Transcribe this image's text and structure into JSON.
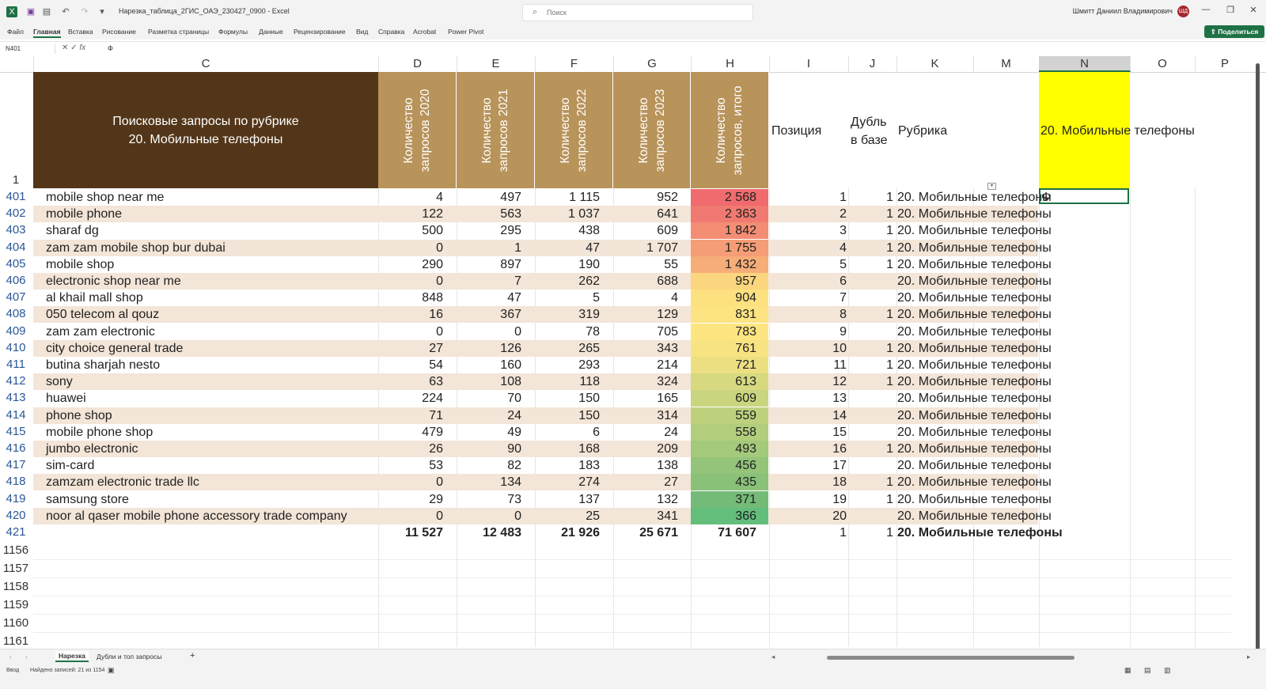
{
  "window": {
    "app_name": "Excel",
    "doc_title": "Нарезка_таблица_2ГИС_ОАЭ_230427_0900  -  Excel",
    "search_placeholder": "Поиск",
    "user_name": "Шмитт Даниил Владимирович",
    "user_initials": "ШД"
  },
  "menu": [
    "Файл",
    "Главная",
    "Вставка",
    "Рисование",
    "Разметка страницы",
    "Формулы",
    "Данные",
    "Рецензирование",
    "Вид",
    "Справка",
    "Acrobat",
    "Power Pivot"
  ],
  "share_label": "Поделиться",
  "formula_bar": {
    "name_box": "N401",
    "fx": "fx",
    "value": "Ф"
  },
  "columns": [
    "C",
    "D",
    "E",
    "F",
    "G",
    "H",
    "I",
    "J",
    "K",
    "M",
    "N",
    "O",
    "P"
  ],
  "header": {
    "title_line1": "Поисковые запросы по рубрике",
    "title_line2": "20. Мобильные телефоны",
    "col_d": "Количество запросов 2020",
    "col_e": "Количество запросов 2021",
    "col_f": "Количество запросов 2022",
    "col_g": "Количество запросов 2023",
    "col_h": "Количество запросов, итого",
    "col_i": "Позиция",
    "col_j": "Дубль в базе",
    "col_k": "Рубрика",
    "col_n": "20. Мобильные телефоны",
    "row_num": "1"
  },
  "rows": [
    {
      "n": "401",
      "c": "mobile shop near me",
      "d": "4",
      "e": "497",
      "f": "1 115",
      "g": "952",
      "h": "2 568",
      "i": "1",
      "j": "1",
      "k": "20. Мобильные телефоны",
      "nval": "Ф"
    },
    {
      "n": "402",
      "c": "mobile phone",
      "d": "122",
      "e": "563",
      "f": "1 037",
      "g": "641",
      "h": "2 363",
      "i": "2",
      "j": "1",
      "k": "20. Мобильные телефоны",
      "nval": ""
    },
    {
      "n": "403",
      "c": "sharaf dg",
      "d": "500",
      "e": "295",
      "f": "438",
      "g": "609",
      "h": "1 842",
      "i": "3",
      "j": "1",
      "k": "20. Мобильные телефоны",
      "nval": ""
    },
    {
      "n": "404",
      "c": "zam zam mobile shop bur dubai",
      "d": "0",
      "e": "1",
      "f": "47",
      "g": "1 707",
      "h": "1 755",
      "i": "4",
      "j": "1",
      "k": "20. Мобильные телефоны",
      "nval": ""
    },
    {
      "n": "405",
      "c": "mobile shop",
      "d": "290",
      "e": "897",
      "f": "190",
      "g": "55",
      "h": "1 432",
      "i": "5",
      "j": "1",
      "k": "20. Мобильные телефоны",
      "nval": ""
    },
    {
      "n": "406",
      "c": "electronic shop near me",
      "d": "0",
      "e": "7",
      "f": "262",
      "g": "688",
      "h": "957",
      "i": "6",
      "j": "",
      "k": "20. Мобильные телефоны",
      "nval": ""
    },
    {
      "n": "407",
      "c": "al khail mall shop",
      "d": "848",
      "e": "47",
      "f": "5",
      "g": "4",
      "h": "904",
      "i": "7",
      "j": "",
      "k": "20. Мобильные телефоны",
      "nval": ""
    },
    {
      "n": "408",
      "c": "050 telecom al qouz",
      "d": "16",
      "e": "367",
      "f": "319",
      "g": "129",
      "h": "831",
      "i": "8",
      "j": "1",
      "k": "20. Мобильные телефоны",
      "nval": ""
    },
    {
      "n": "409",
      "c": "zam zam electronic",
      "d": "0",
      "e": "0",
      "f": "78",
      "g": "705",
      "h": "783",
      "i": "9",
      "j": "",
      "k": "20. Мобильные телефоны",
      "nval": ""
    },
    {
      "n": "410",
      "c": "city choice general trade",
      "d": "27",
      "e": "126",
      "f": "265",
      "g": "343",
      "h": "761",
      "i": "10",
      "j": "1",
      "k": "20. Мобильные телефоны",
      "nval": ""
    },
    {
      "n": "411",
      "c": "butina sharjah nesto",
      "d": "54",
      "e": "160",
      "f": "293",
      "g": "214",
      "h": "721",
      "i": "11",
      "j": "1",
      "k": "20. Мобильные телефоны",
      "nval": ""
    },
    {
      "n": "412",
      "c": "sony",
      "d": "63",
      "e": "108",
      "f": "118",
      "g": "324",
      "h": "613",
      "i": "12",
      "j": "1",
      "k": "20. Мобильные телефоны",
      "nval": ""
    },
    {
      "n": "413",
      "c": "huawei",
      "d": "224",
      "e": "70",
      "f": "150",
      "g": "165",
      "h": "609",
      "i": "13",
      "j": "",
      "k": "20. Мобильные телефоны",
      "nval": ""
    },
    {
      "n": "414",
      "c": "phone shop",
      "d": "71",
      "e": "24",
      "f": "150",
      "g": "314",
      "h": "559",
      "i": "14",
      "j": "",
      "k": "20. Мобильные телефоны",
      "nval": ""
    },
    {
      "n": "415",
      "c": "mobile phone shop",
      "d": "479",
      "e": "49",
      "f": "6",
      "g": "24",
      "h": "558",
      "i": "15",
      "j": "",
      "k": "20. Мобильные телефоны",
      "nval": ""
    },
    {
      "n": "416",
      "c": "jumbo electronic",
      "d": "26",
      "e": "90",
      "f": "168",
      "g": "209",
      "h": "493",
      "i": "16",
      "j": "1",
      "k": "20. Мобильные телефоны",
      "nval": ""
    },
    {
      "n": "417",
      "c": "sim-card",
      "d": "53",
      "e": "82",
      "f": "183",
      "g": "138",
      "h": "456",
      "i": "17",
      "j": "",
      "k": "20. Мобильные телефоны",
      "nval": ""
    },
    {
      "n": "418",
      "c": "zamzam electronic trade llc",
      "d": "0",
      "e": "134",
      "f": "274",
      "g": "27",
      "h": "435",
      "i": "18",
      "j": "1",
      "k": "20. Мобильные телефоны",
      "nval": ""
    },
    {
      "n": "419",
      "c": "samsung store",
      "d": "29",
      "e": "73",
      "f": "137",
      "g": "132",
      "h": "371",
      "i": "19",
      "j": "1",
      "k": "20. Мобильные телефоны",
      "nval": ""
    },
    {
      "n": "420",
      "c": "noor al qaser mobile phone accessory trade company",
      "d": "0",
      "e": "0",
      "f": "25",
      "g": "341",
      "h": "366",
      "i": "20",
      "j": "",
      "k": "20. Мобильные телефоны",
      "nval": ""
    }
  ],
  "heat_colors": [
    "#ef6b6d",
    "#f07a71",
    "#f38d74",
    "#f59d76",
    "#f6ad78",
    "#fcd67f",
    "#fde080",
    "#fee382",
    "#fde581",
    "#f8e383",
    "#ecdf82",
    "#d6d980",
    "#cbd57f",
    "#bdd17d",
    "#b2ce7d",
    "#a3c97b",
    "#93c47a",
    "#89c179",
    "#75bb78",
    "#63be7b"
  ],
  "total": {
    "n": "421",
    "d": "11 527",
    "e": "12 483",
    "f": "21 926",
    "g": "25 671",
    "h": "71 607",
    "i": "1",
    "j": "1",
    "k": "20. Мобильные телефоны"
  },
  "empty_rows": [
    "1156",
    "1157",
    "1158",
    "1159",
    "1160",
    "1161"
  ],
  "sheet_tabs": [
    "Нарезка",
    "Дубли и топ запросы"
  ],
  "add_sheet": "+",
  "status": {
    "mode": "Ввод",
    "records": "Найдено записей: 21 из 1154"
  }
}
